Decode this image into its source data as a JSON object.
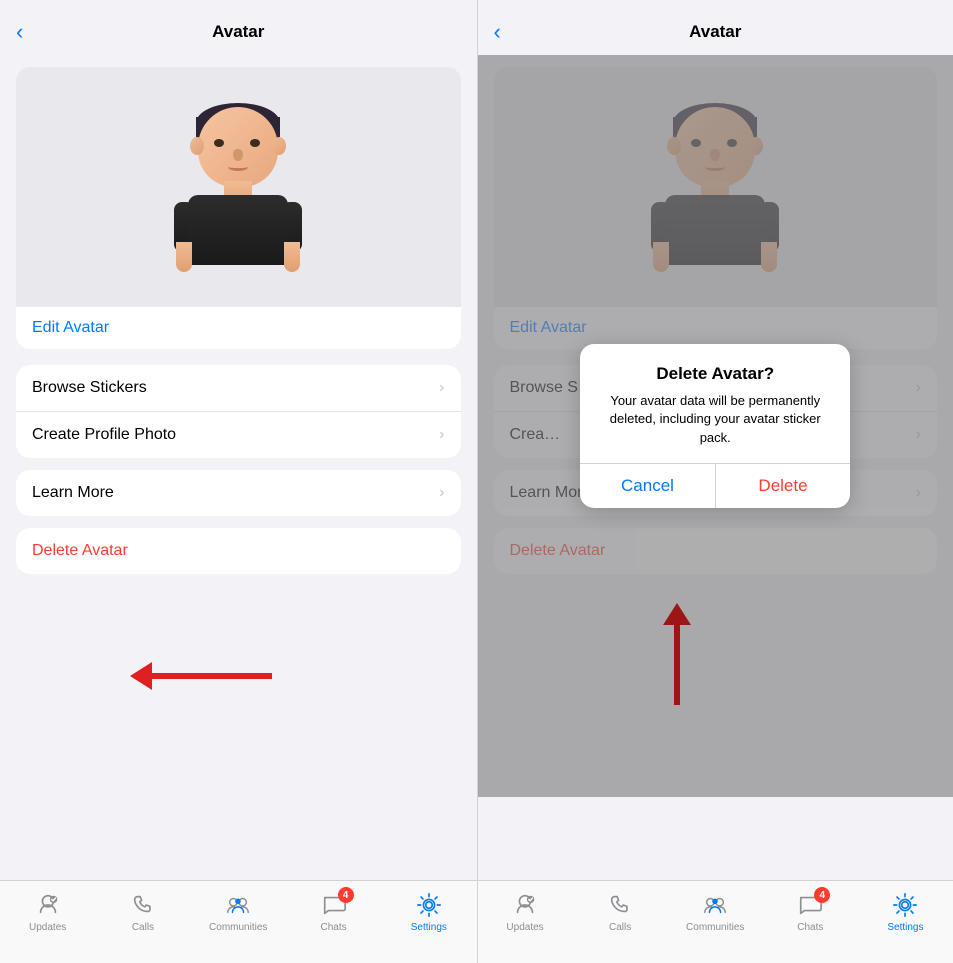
{
  "left_panel": {
    "header": {
      "back_label": "‹",
      "title": "Avatar"
    },
    "avatar": {
      "edit_label": "Edit Avatar"
    },
    "menu_groups": [
      {
        "id": "group1",
        "items": [
          {
            "id": "browse_stickers",
            "label": "Browse Stickers",
            "has_chevron": true,
            "red": false
          },
          {
            "id": "create_profile_photo",
            "label": "Create Profile Photo",
            "has_chevron": true,
            "red": false
          }
        ]
      },
      {
        "id": "group2",
        "items": [
          {
            "id": "learn_more",
            "label": "Learn More",
            "has_chevron": true,
            "red": false
          }
        ]
      },
      {
        "id": "group3",
        "items": [
          {
            "id": "delete_avatar",
            "label": "Delete Avatar",
            "has_chevron": false,
            "red": true
          }
        ]
      }
    ],
    "arrow": {
      "direction": "left",
      "target": "delete_avatar"
    }
  },
  "right_panel": {
    "header": {
      "back_label": "‹",
      "title": "Avatar"
    },
    "avatar": {
      "edit_label": "Edit Avatar"
    },
    "menu_groups": [
      {
        "id": "group1",
        "items": [
          {
            "id": "browse_stickers",
            "label": "Browse Stickers",
            "has_chevron": true,
            "red": false
          },
          {
            "id": "create_profile_photo",
            "label": "Create Profile Photo",
            "has_chevron": true,
            "red": false
          }
        ]
      },
      {
        "id": "group2",
        "items": [
          {
            "id": "learn_more",
            "label": "Learn More",
            "has_chevron": true,
            "red": false
          }
        ]
      },
      {
        "id": "group3",
        "items": [
          {
            "id": "delete_avatar",
            "label": "Delete Avatar",
            "has_chevron": false,
            "red": true
          }
        ]
      }
    ],
    "dialog": {
      "title": "Delete Avatar?",
      "message": "Your avatar data will be permanently deleted, including your avatar sticker pack.",
      "cancel_label": "Cancel",
      "delete_label": "Delete"
    },
    "arrow": {
      "direction": "up",
      "target": "delete_button"
    }
  },
  "tab_bar": {
    "items": [
      {
        "id": "updates",
        "label": "Updates",
        "active": false
      },
      {
        "id": "calls",
        "label": "Calls",
        "active": false
      },
      {
        "id": "communities",
        "label": "Communities",
        "active": false
      },
      {
        "id": "chats",
        "label": "Chats",
        "active": false,
        "badge": "4"
      },
      {
        "id": "settings",
        "label": "Settings",
        "active": true
      }
    ]
  },
  "colors": {
    "accent": "#007aff",
    "red": "#ff3b30",
    "dark_red_arrow": "#e02020",
    "tab_active": "#007aff",
    "tab_inactive": "#8e8e93",
    "menu_red": "#ff3b30"
  }
}
